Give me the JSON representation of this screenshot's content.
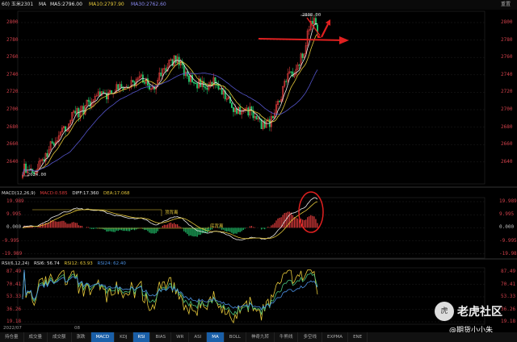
{
  "header": {
    "code": "60) 玉米2301",
    "ma_label": "MA",
    "ma5": "MA5:2796.00",
    "ma10": "MA10:2797.90",
    "ma30": "MA30:2762.60",
    "reset": "重置"
  },
  "price_axis": {
    "ticks": [
      "2800",
      "2780",
      "2760",
      "2740",
      "2720",
      "2700",
      "2680",
      "2660",
      "2640"
    ]
  },
  "annotations": {
    "high": "2808.00",
    "low": "2624.00"
  },
  "macd": {
    "header_name": "MACD(12,26,9)",
    "header_macd": "MACD:0.585",
    "header_diff": "DIFF:17.360",
    "header_dea": "DEA:17.068",
    "ticks": [
      "19.989",
      "9.995",
      "0.000",
      "-9.995",
      "-19.989"
    ],
    "marker1": "顶背离",
    "marker2": "底背离"
  },
  "rsi": {
    "header_name": "RSI(6,12,24)",
    "header_rsi6": "RSI6: 56.74",
    "header_rsi12": "RSI12: 63.93",
    "header_rsi24": "RSI24: 62.40",
    "ticks": [
      "87.49",
      "70.41",
      "53.33",
      "36.26",
      "19.18"
    ]
  },
  "xaxis": {
    "label1": "2022/07",
    "label2": "08"
  },
  "tabs": [
    "持仓量",
    "成交量",
    "成交额",
    "涨跌",
    "MACD",
    "KDJ",
    "RSI",
    "BIAS",
    "WR",
    "ASI",
    "MA",
    "BOLL",
    "神奇九转",
    "牛熊线",
    "多空线",
    "EXPMA",
    "ENE"
  ],
  "active_tabs": [
    "MACD",
    "RSI",
    "MA"
  ],
  "watermark": {
    "logo": "虎",
    "text": "老虎社区",
    "sub": "@期货小小朱"
  },
  "colors": {
    "up": "#e03c3c",
    "down": "#21c46b",
    "ma5": "#e8e8e8",
    "ma10": "#e5c83a",
    "ma30": "#5555cc",
    "accent": "#1a5fa8"
  }
}
